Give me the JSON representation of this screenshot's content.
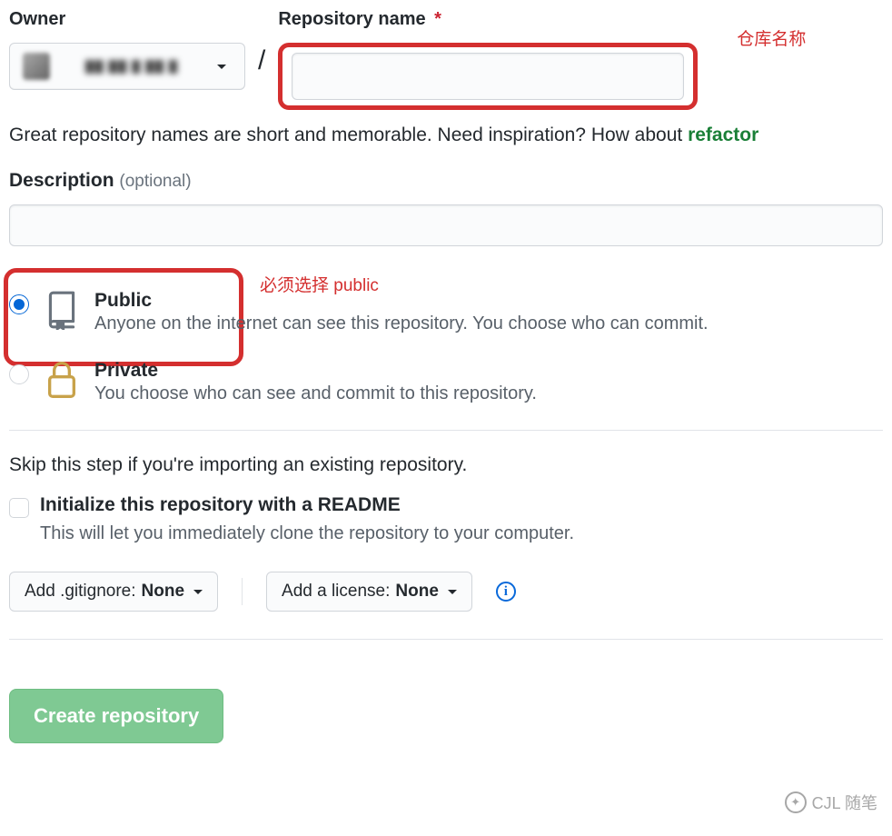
{
  "fields": {
    "owner_label": "Owner",
    "reponame_label": "Repository name",
    "required_mark": "*",
    "description_label": "Description",
    "description_optional": "(optional)",
    "reponame_value": "",
    "description_value": ""
  },
  "help": {
    "text_prefix": "Great repository names are short and memorable. Need inspiration? How about ",
    "suggestion": "refactor"
  },
  "annotations": {
    "repo_name": "仓库名称",
    "public_req": "必须选择 public"
  },
  "visibility": {
    "public": {
      "title": "Public",
      "desc": "Anyone on the internet can see this repository. You choose who can commit."
    },
    "private": {
      "title": "Private",
      "desc": "You choose who can see and commit to this repository."
    }
  },
  "init": {
    "skip_text": "Skip this step if you're importing an existing repository.",
    "readme_label": "Initialize this repository with a README",
    "readme_desc": "This will let you immediately clone the repository to your computer."
  },
  "selectors": {
    "gitignore_prefix": "Add .gitignore: ",
    "gitignore_value": "None",
    "license_prefix": "Add a license: ",
    "license_value": "None"
  },
  "actions": {
    "create": "Create repository"
  },
  "watermark": "CJL 随笔"
}
